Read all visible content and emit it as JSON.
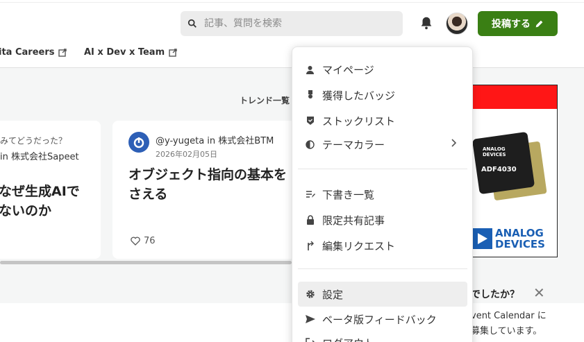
{
  "header": {
    "search_placeholder": "記事、質問を検索",
    "post_button_label": "投稿する",
    "nav_links": [
      "ita Careers",
      "AI x Dev x Team"
    ]
  },
  "main": {
    "trend_title": "トレンド一覧",
    "cards": [
      {
        "line1": "みてどうだった？",
        "line2": "in 株式会社Sapeet",
        "title_lines": [
          "なぜ生成AIで",
          "ないのか"
        ]
      },
      {
        "author": "@y-yugeta in 株式会社BTM",
        "date": "2026年02月05日",
        "title_lines": [
          "オブジェクト指向の基本を",
          "さえる"
        ],
        "likes": "76"
      }
    ]
  },
  "ad": {
    "chip_brand": [
      "ANALOG",
      "DEVICES"
    ],
    "chip_model": "ADF4030",
    "logo_lines": [
      "ANALOG",
      "DEVICES"
    ]
  },
  "notice": {
    "title": "でしたか？",
    "lines": [
      "vent Calendar に",
      "募集しています。"
    ]
  },
  "user_menu": {
    "groups": [
      [
        {
          "label": "マイページ",
          "icon": "person-icon"
        },
        {
          "label": "獲得したバッジ",
          "icon": "badge-icon"
        },
        {
          "label": "ストックリスト",
          "icon": "stock-icon"
        },
        {
          "label": "テーマカラー",
          "icon": "theme-icon",
          "has_submenu": true
        }
      ],
      [
        {
          "label": "下書き一覧",
          "icon": "drafts-icon"
        },
        {
          "label": "限定共有記事",
          "icon": "lock-icon"
        },
        {
          "label": "編集リクエスト",
          "icon": "edit-request-icon"
        }
      ],
      [
        {
          "label": "設定",
          "icon": "gear-icon",
          "active": true
        },
        {
          "label": "ベータ版フィードバック",
          "icon": "send-icon"
        },
        {
          "label": "ログアウト",
          "icon": "logout-icon"
        }
      ]
    ]
  },
  "colors": {
    "accent_green": "#3a7f14",
    "ad_red": "#ff1616",
    "ad_blue": "#1a5fb4"
  }
}
